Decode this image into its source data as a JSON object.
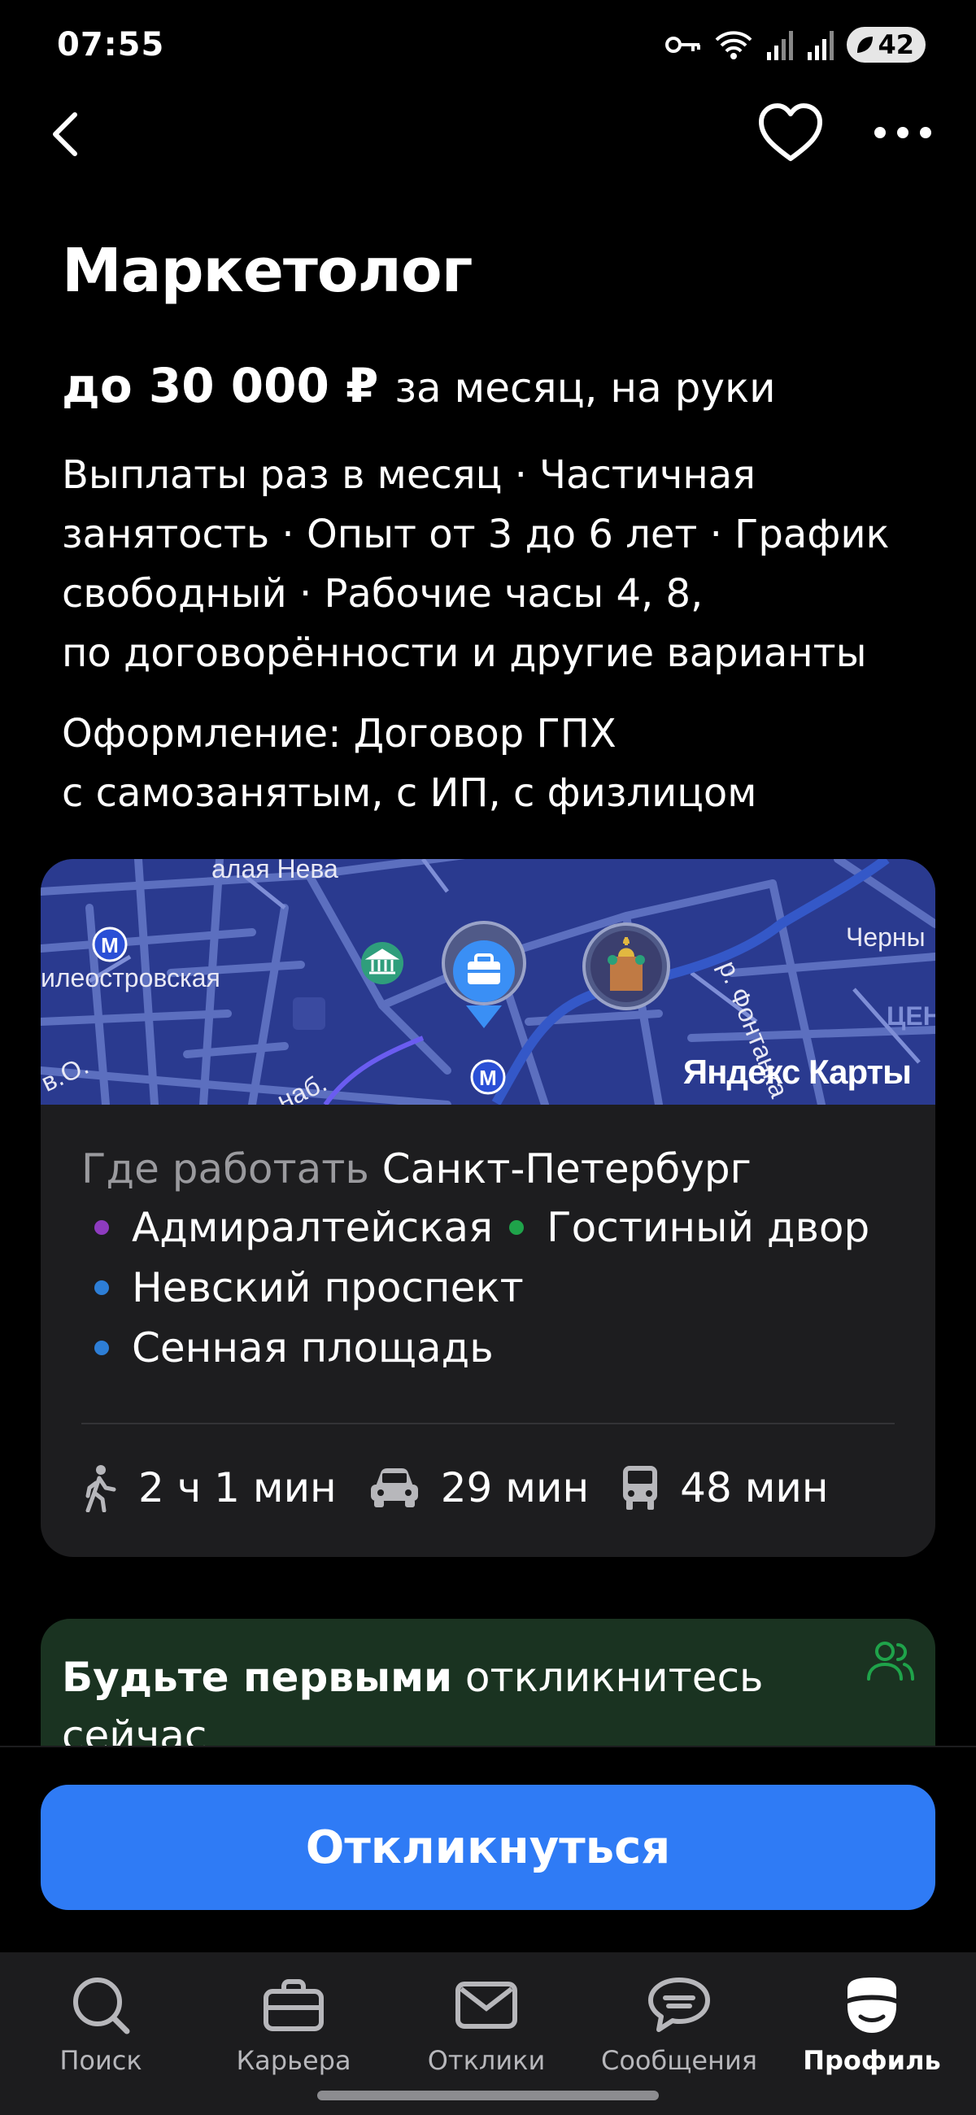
{
  "status_bar": {
    "time": "07:55",
    "battery": "42"
  },
  "job": {
    "title": "Маркетолог",
    "salary_amount": "до 30 000 ₽",
    "salary_note": "за месяц, на руки",
    "conditions_lines": [
      "Выплаты раз в месяц · Частичная",
      "занятость · Опыт от 3 до 6 лет · График",
      "свободный · Рабочие часы 4, 8,",
      "по договорённости и другие варианты"
    ],
    "registration_lines": [
      "Оформление: Договор ГПХ",
      "с самозанятым, с ИП, с физлицом"
    ]
  },
  "map": {
    "labels": {
      "neva": "алая Нева",
      "station": "илеостровская",
      "river": "р. Фонтанка",
      "cherny": "Черны",
      "embankment": "наб.",
      "short": "в.О.",
      "center": "ЦЕН"
    },
    "brand": "Яндекс Карты"
  },
  "location": {
    "label": "Где работать",
    "city": "Санкт-Петербург",
    "metro": [
      {
        "name": "Адмиралтейская",
        "color": "#8e3bbf"
      },
      {
        "name": "Гостиный двор",
        "color": "#1fa34a"
      },
      {
        "name": "Невский проспект",
        "color": "#2d7ed6"
      },
      {
        "name": "Сенная площадь",
        "color": "#2d7ed6"
      }
    ],
    "travel": {
      "walk": "2 ч 1 мин",
      "car": "29 мин",
      "transit": "48 мин"
    }
  },
  "promo": {
    "bold": "Будьте первыми",
    "rest": "откликнитесь",
    "line2": "сейчас",
    "accent": "#1fa34a"
  },
  "respond_button": "Откликнуться",
  "tabs": [
    {
      "label": "Поиск",
      "icon": "search-icon"
    },
    {
      "label": "Карьера",
      "icon": "briefcase-icon"
    },
    {
      "label": "Отклики",
      "icon": "envelope-icon"
    },
    {
      "label": "Сообщения",
      "icon": "chat-icon"
    },
    {
      "label": "Профиль",
      "icon": "profile-icon",
      "active": true
    }
  ],
  "colors": {
    "accent": "#2f7bf5",
    "card": "#1d1d1f",
    "promo_bg": "#1a3321"
  }
}
